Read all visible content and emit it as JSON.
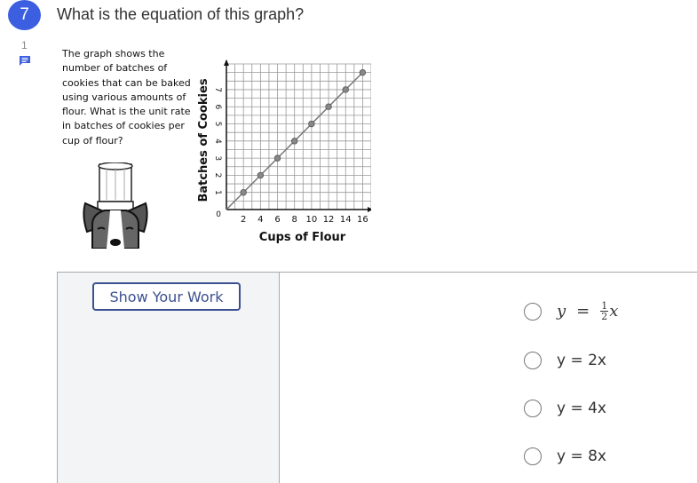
{
  "question": {
    "number": "7",
    "comment_count": "1",
    "title": "What is the equation of this graph?",
    "prompt": "The graph shows the number of batches of cookies that can be baked using various amounts of flour.  What is the unit rate in batches of cookies per cup of flour?"
  },
  "work_panel": {
    "show_work_label": "Show Your Work"
  },
  "choices": [
    {
      "label": "y = ½x",
      "math": {
        "lhs": "y",
        "eq": "=",
        "num": "1",
        "den": "2",
        "var": "x"
      }
    },
    {
      "label": "y = 2x"
    },
    {
      "label": "y = 4x"
    },
    {
      "label": "y = 8x"
    }
  ],
  "colors": {
    "accent": "#3b5fe0",
    "button_border": "#3c5091",
    "panel_bg": "#f3f4f6"
  },
  "chart_data": {
    "type": "line",
    "xlabel": "Cups of Flour",
    "ylabel": "Batches of Cookies",
    "x": [
      0,
      2,
      4,
      6,
      8,
      10,
      12,
      14,
      16
    ],
    "y": [
      0,
      1,
      2,
      3,
      4,
      5,
      6,
      7,
      8
    ],
    "points": [
      [
        2,
        1
      ],
      [
        4,
        2
      ],
      [
        6,
        3
      ],
      [
        8,
        4
      ],
      [
        10,
        5
      ],
      [
        12,
        6
      ],
      [
        14,
        7
      ],
      [
        16,
        8
      ]
    ],
    "xticks": [
      "2",
      "4",
      "6",
      "8",
      "10",
      "12",
      "14",
      "16"
    ],
    "yticks": [
      "1",
      "2",
      "3",
      "4",
      "5",
      "6",
      "7"
    ],
    "origin_label": "0",
    "xlim": [
      0,
      17
    ],
    "ylim": [
      0,
      8.5
    ],
    "grid": true
  }
}
